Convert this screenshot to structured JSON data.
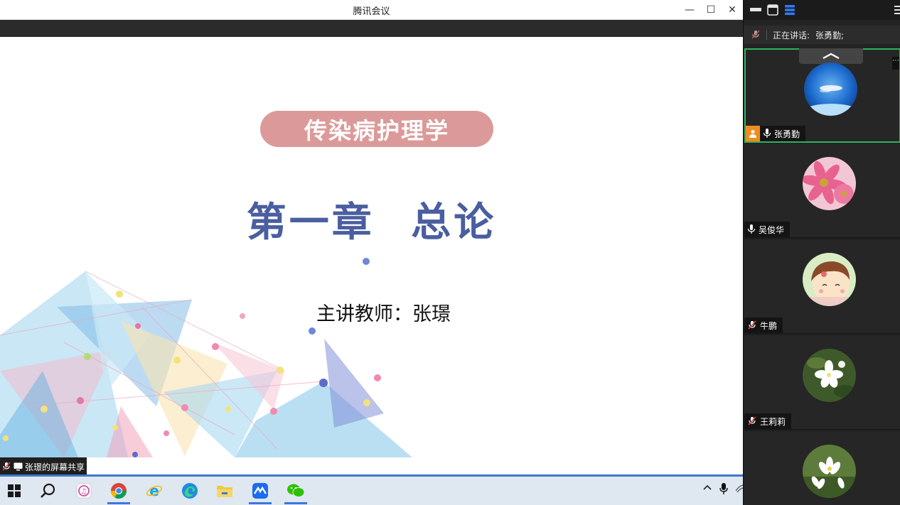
{
  "window": {
    "title": "腾讯会议",
    "minimize_label": "—",
    "maximize_label": "☐",
    "close_label": "✕"
  },
  "slide": {
    "course_title": "传染病护理学",
    "chapter_part1": "第一章",
    "chapter_part2": "总论",
    "lecturer": "主讲教师：张璟",
    "colors": {
      "pill": "#db9a99",
      "chapter": "#4a5ea0"
    }
  },
  "share": {
    "label": "张璟的屏幕共享"
  },
  "panel": {
    "speaking_label": "正在讲话:",
    "speaking_name": "张勇勤;",
    "participants": [
      {
        "name": "张勇勤",
        "mic": "on",
        "host": true,
        "active": true,
        "avatar": "sky-avatar"
      },
      {
        "name": "吴俊华",
        "mic": "on",
        "host": false,
        "active": false,
        "avatar": "pink-flower-avatar"
      },
      {
        "name": "牛鹏",
        "mic": "muted",
        "host": false,
        "active": false,
        "avatar": "cartoon-girl-avatar"
      },
      {
        "name": "王莉莉",
        "mic": "muted",
        "host": false,
        "active": false,
        "avatar": "white-flower-avatar"
      },
      {
        "name": "",
        "mic": "",
        "host": false,
        "active": false,
        "avatar": "lotus-avatar"
      }
    ]
  },
  "taskbar": {
    "apps": [
      "windows-start-icon",
      "search-icon",
      "itunes-icon",
      "chrome-icon",
      "ie-icon",
      "edge-icon",
      "file-explorer-icon",
      "tencent-meeting-icon",
      "wechat-icon"
    ],
    "tray": [
      "chevron-up-icon",
      "microphone-icon",
      "wifi-icon"
    ]
  }
}
